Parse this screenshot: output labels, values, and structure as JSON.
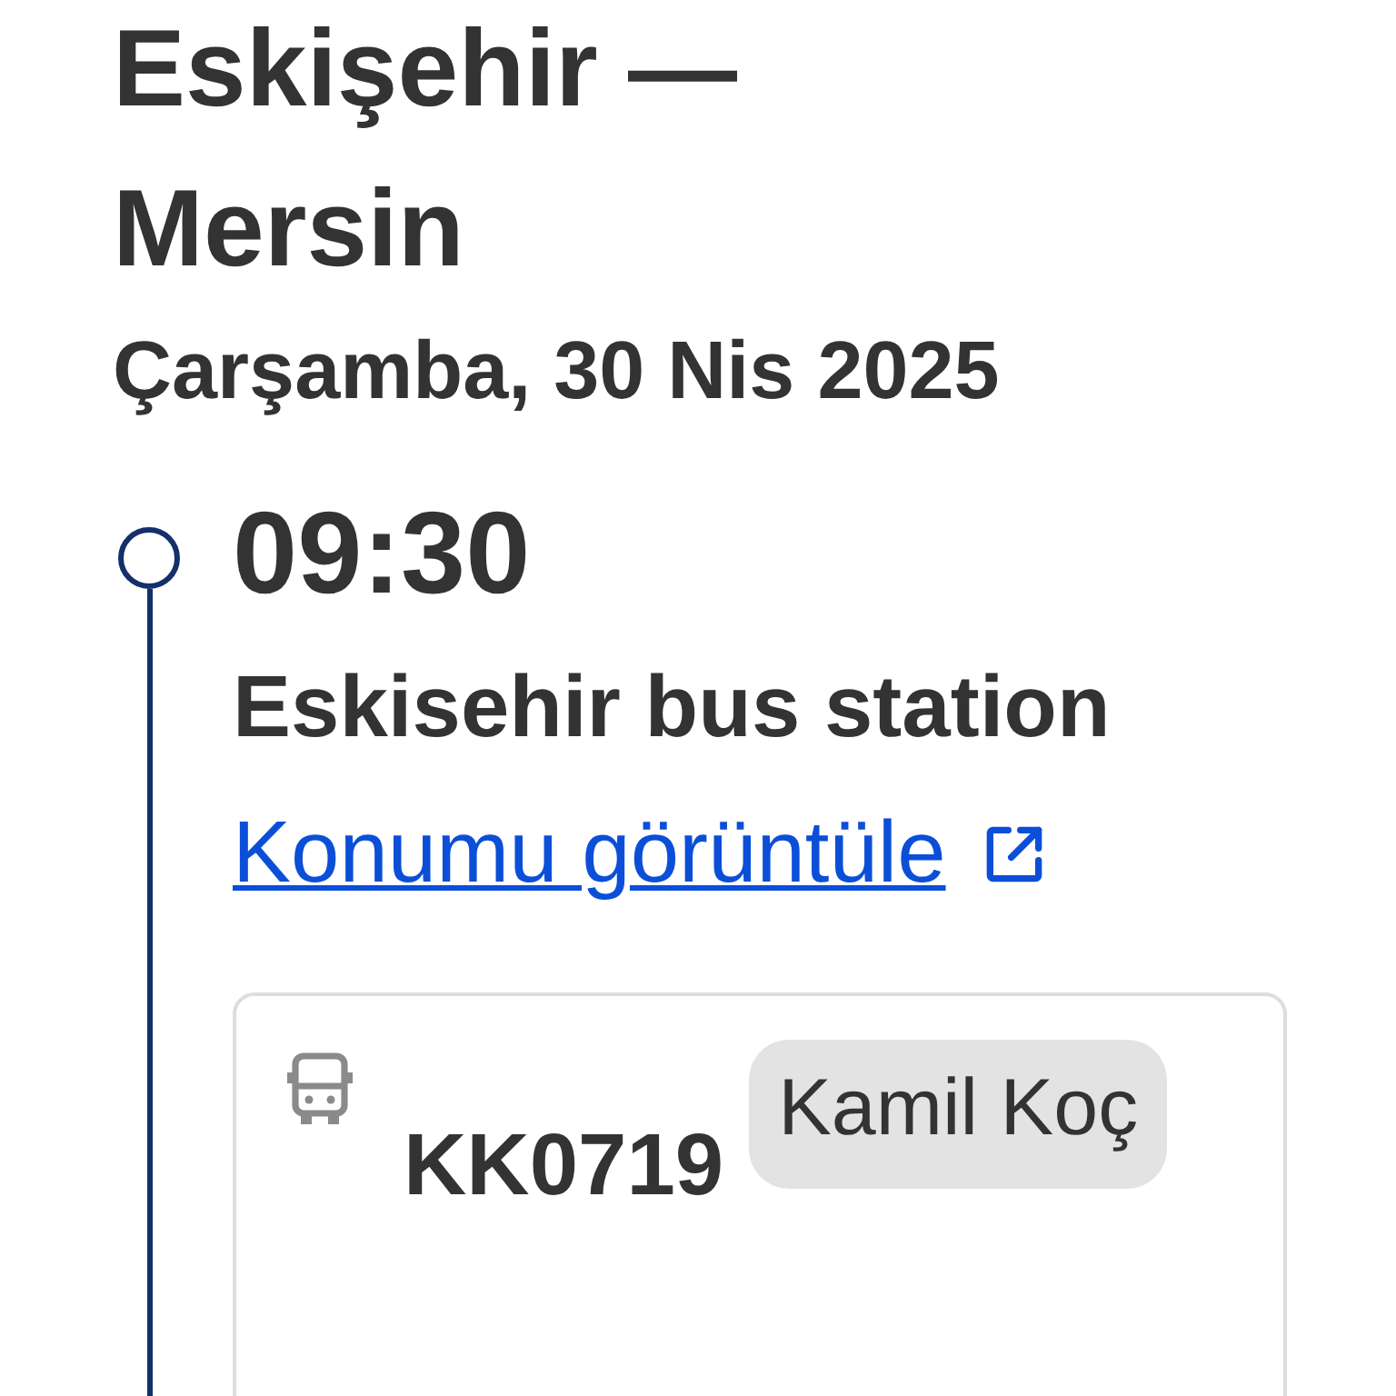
{
  "route_title": "Eskişehir — Mersin",
  "date": "Çarşamba, 30 Nis 2025",
  "stops": [
    {
      "time": "09:30",
      "station": "Eskisehir bus station",
      "map_link": "Konumu görüntüle",
      "trip": {
        "code": "KK0719",
        "operator": "Kamil Koç"
      }
    }
  ]
}
